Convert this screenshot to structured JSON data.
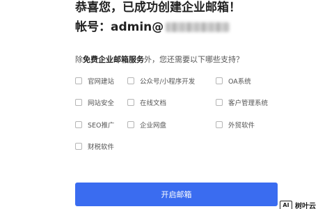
{
  "header": {
    "success_title": "恭喜您，已成功创建企业邮箱！",
    "account_label": "帐号：admin@"
  },
  "services": {
    "prompt_prefix": "除",
    "prompt_bold": "免费企业邮箱服务",
    "prompt_suffix": "外，您还需要以下哪些支持？",
    "options": [
      {
        "label": "官网建站",
        "checked": false
      },
      {
        "label": "公众号/小程序开发",
        "checked": false
      },
      {
        "label": "OA系统",
        "checked": false
      },
      {
        "label": "网站安全",
        "checked": false
      },
      {
        "label": "在线文档",
        "checked": false
      },
      {
        "label": "客户管理系统",
        "checked": false
      },
      {
        "label": "SEO推广",
        "checked": false
      },
      {
        "label": "企业网盘",
        "checked": false
      },
      {
        "label": "外贸软件",
        "checked": false
      },
      {
        "label": "财税软件",
        "checked": false
      }
    ]
  },
  "actions": {
    "open_mailbox": "开启邮箱"
  },
  "watermark": {
    "logo_text": "AI",
    "brand_text": "树叶云"
  },
  "colors": {
    "primary_button": "#3a6cf0",
    "title_text": "#222222"
  }
}
